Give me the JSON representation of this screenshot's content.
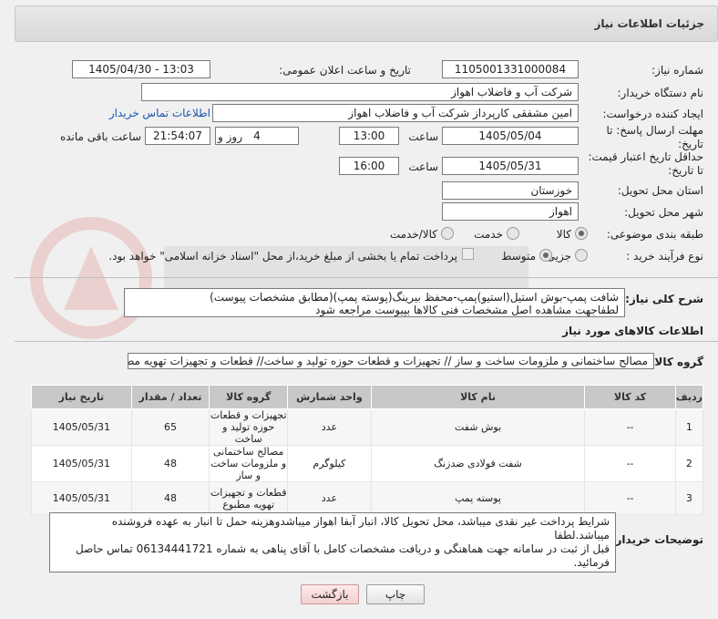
{
  "header": {
    "title": "جزئیات اطلاعات نیاز"
  },
  "form": {
    "need_number_label": "شماره نیاز:",
    "need_number": "1105001331000084",
    "announce_datetime_label": "تاریخ و ساعت اعلان عمومی:",
    "announce_datetime": "1405/04/30 - 13:03",
    "buyer_org_label": "نام دستگاه خریدار:",
    "buyer_org": "شرکت آب و فاضلاب اهواز",
    "requester_label": "ایجاد کننده درخواست:",
    "requester": "امین مشفقی کارپرداز شرکت آب و فاضلاب اهواز",
    "buyer_contact_link": "اطلاعات تماس خریدار",
    "reply_deadline_label": "مهلت ارسال پاسخ: تا تاریخ:",
    "reply_date": "1405/05/04",
    "time_label": "ساعت",
    "reply_time": "13:00",
    "days_value": "4",
    "days_label": "روز و",
    "remaining_time": "21:54:07",
    "remaining_label": "ساعت باقی مانده",
    "validity_label": "حداقل تاریخ اعتبار قیمت: تا تاریخ:",
    "validity_date": "1405/05/31",
    "validity_time": "16:00",
    "province_label": "استان محل تحویل:",
    "province": "خوزستان",
    "city_label": "شهر محل تحویل:",
    "city": "اهواز",
    "category_label": "طبقه بندی موضوعی:",
    "category_options": [
      "کالا",
      "خدمت",
      "کالا/خدمت"
    ],
    "category_selected": "کالا",
    "purchase_type_label": "نوع فرآیند خرید :",
    "purchase_options": [
      "جزیی",
      "متوسط"
    ],
    "purchase_selected": "متوسط",
    "payment_note": "پرداخت تمام یا بخشی از مبلغ خرید،از محل \"اسناد خزانه اسلامی\" خواهد بود."
  },
  "description": {
    "label": "شرح کلی نیاز:",
    "line1": "شافت پمپ-بوش استیل(استیو)پمپ-محفظ بیرینگ(پوسته پمپ)(مطابق مشخصات پیوست)",
    "line2": "لطفاجهت مشاهده اصل مشخصات فنی کالاها بپیوست مراجعه شود"
  },
  "goods_info": {
    "section_title": "اطلاعات کالاهای مورد نیاز",
    "group_label": "گروه کالا:",
    "group_value": "مصالح ساختمانی و ملزومات ساخت و ساز // تجهیزات و قطعات حوزه تولید و ساخت//  قطعات و تجهیزات تهویه مطبوع"
  },
  "table": {
    "headers": [
      "ردیف",
      "کد کالا",
      "نام کالا",
      "واحد شمارش",
      "گروه کالا",
      "تعداد / مقدار",
      "تاریخ نیاز"
    ],
    "rows": [
      {
        "idx": "1",
        "code": "--",
        "name": "بوش شفت",
        "unit": "عدد",
        "group": "تجهیزات و قطعات حوزه تولید و ساخت",
        "qty": "65",
        "date": "1405/05/31"
      },
      {
        "idx": "2",
        "code": "--",
        "name": "شفت فولادی ضدزنگ",
        "unit": "کیلوگرم",
        "group": "مصالح ساختمانی و ملزومات ساخت و ساز",
        "qty": "48",
        "date": "1405/05/31"
      },
      {
        "idx": "3",
        "code": "--",
        "name": "پوسته پمپ",
        "unit": "عدد",
        "group": "قطعات و تجهیزات تهویه مطبوع",
        "qty": "48",
        "date": "1405/05/31"
      }
    ]
  },
  "buyer_notes": {
    "label": "توضیحات خریدار:",
    "line1": "شرایط پرداخت غیر نقدی میباشد، محل تحویل کالا، انبار آبفا اهواز میباشدوهزینه حمل تا انبار به عهده فروشنده میباشد.لطفا",
    "line2": "قبل از ثبت در سامانه جهت هماهنگی و دریافت مشخصات کامل با آقای  پناهی به شماره 06134441721  تماس حاصل",
    "line3": "فرمائید."
  },
  "buttons": {
    "print": "چاپ",
    "back": "بازگشت"
  },
  "colors": {
    "link": "#1a56b0",
    "header_bg": "#d9d9d9",
    "table_header": "#c8c8c8"
  }
}
